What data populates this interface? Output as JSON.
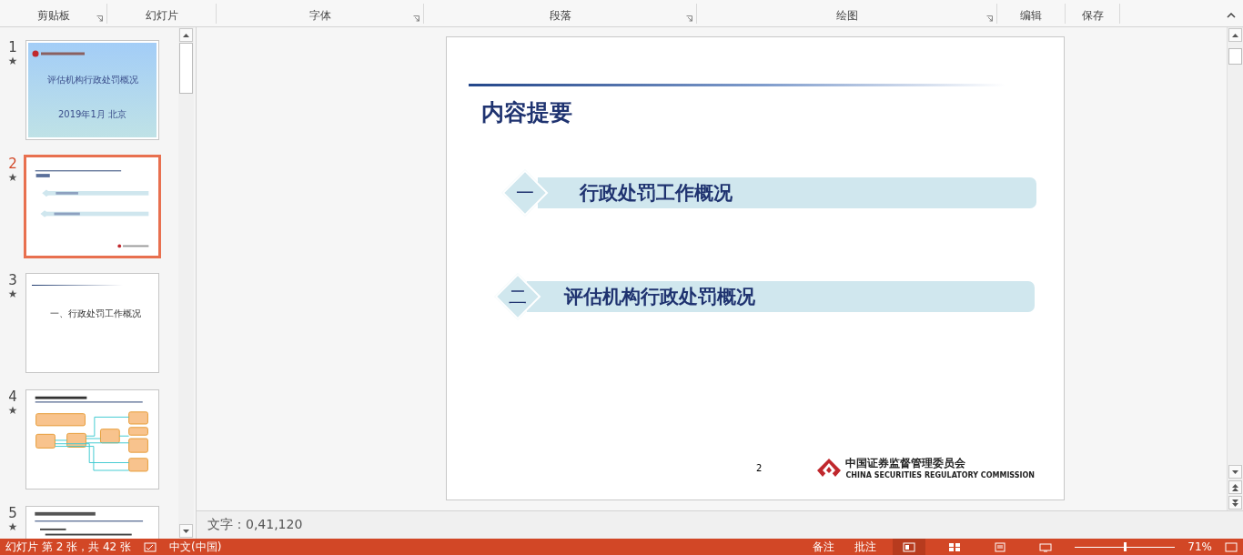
{
  "ribbon_groups": [
    {
      "label": "剪贴板",
      "has_launcher": true
    },
    {
      "label": "幻灯片",
      "has_launcher": false
    },
    {
      "label": "字体",
      "has_launcher": true
    },
    {
      "label": "段落",
      "has_launcher": true
    },
    {
      "label": "绘图",
      "has_launcher": true
    },
    {
      "label": "编辑",
      "has_launcher": false
    },
    {
      "label": "保存",
      "has_launcher": false
    }
  ],
  "thumbnails": [
    {
      "number": "1",
      "selected": false,
      "kind": "title",
      "title": "评估机构行政处罚概况",
      "subtitle": "2019年1月 北京"
    },
    {
      "number": "2",
      "selected": true,
      "kind": "agenda"
    },
    {
      "number": "3",
      "selected": false,
      "kind": "section",
      "title": "一、行政处罚工作概况"
    },
    {
      "number": "4",
      "selected": false,
      "kind": "diagram"
    },
    {
      "number": "5",
      "selected": false,
      "kind": "list"
    }
  ],
  "slide": {
    "title": "内容提要",
    "items": [
      {
        "numeral": "一",
        "text": "行政处罚工作概况"
      },
      {
        "numeral": "二",
        "text": "评估机构行政处罚概况"
      }
    ],
    "page_number": "2",
    "logo": {
      "name": "中国证券监督管理委员会",
      "english": "CHINA SECURITIES REGULATORY COMMISSION"
    }
  },
  "notes": "文字：0,41,120",
  "status_bar": {
    "slide_info": "幻灯片 第 2 张，共 42 张",
    "language": "中文(中国)",
    "notes_button": "备注",
    "comments_button": "批注",
    "views": [
      {
        "selected": true
      },
      {
        "selected": false
      },
      {
        "selected": false
      },
      {
        "selected": false
      }
    ],
    "zoom_slider": {
      "level": 0.5
    },
    "zoom": "71%"
  }
}
